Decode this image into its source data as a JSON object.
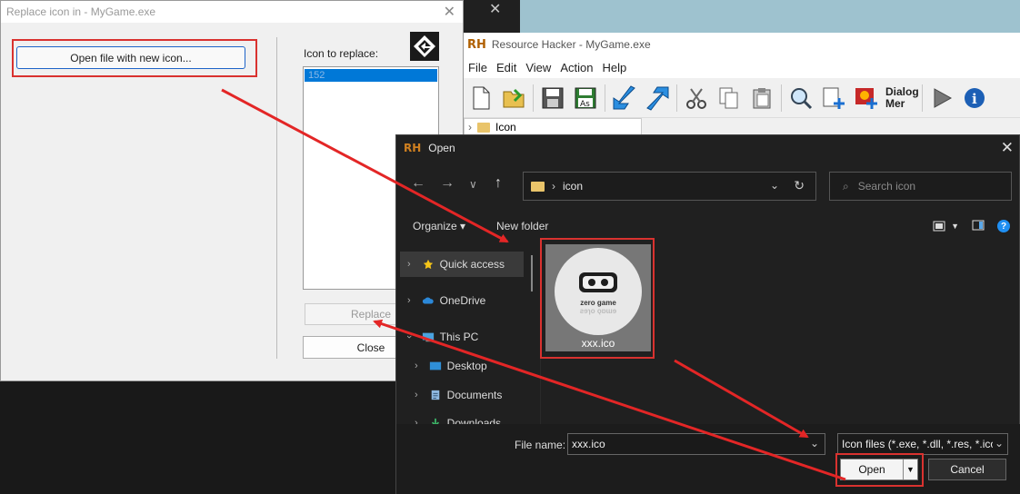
{
  "replace_dialog": {
    "title": "Replace icon in - MyGame.exe",
    "open_button": "Open file with new icon...",
    "label": "Icon to replace:",
    "list_item": "152",
    "replace_button": "Replace",
    "close_button": "Close"
  },
  "resource_hacker": {
    "logo": "RH",
    "title": "Resource Hacker - MyGame.exe",
    "menu": [
      "File",
      "Edit",
      "View",
      "Action",
      "Help"
    ],
    "dialog_merge": [
      "Dialog",
      "Mer"
    ],
    "tree_item": "Icon"
  },
  "open_dialog": {
    "logo": "RH",
    "title": "Open",
    "address_folder": "icon",
    "search_placeholder": "Search icon",
    "organize": "Organize",
    "new_folder": "New folder",
    "nav_items": [
      "Quick access",
      "OneDrive",
      "This PC",
      "Desktop",
      "Documents",
      "Downloads"
    ],
    "file_name": "xxx.ico",
    "thumb_text_1": "zero game",
    "thumb_text_2": "ƨɘɿo ǫɒɯɘ",
    "filename_label": "File name:",
    "filename_value": "xxx.ico",
    "filetype_value": "Icon files (*.exe, *.dll, *.res, *.ico",
    "open_button": "Open",
    "cancel_button": "Cancel"
  },
  "colors": {
    "annotation_red": "#d9322f",
    "selection_blue": "#0078d7"
  }
}
